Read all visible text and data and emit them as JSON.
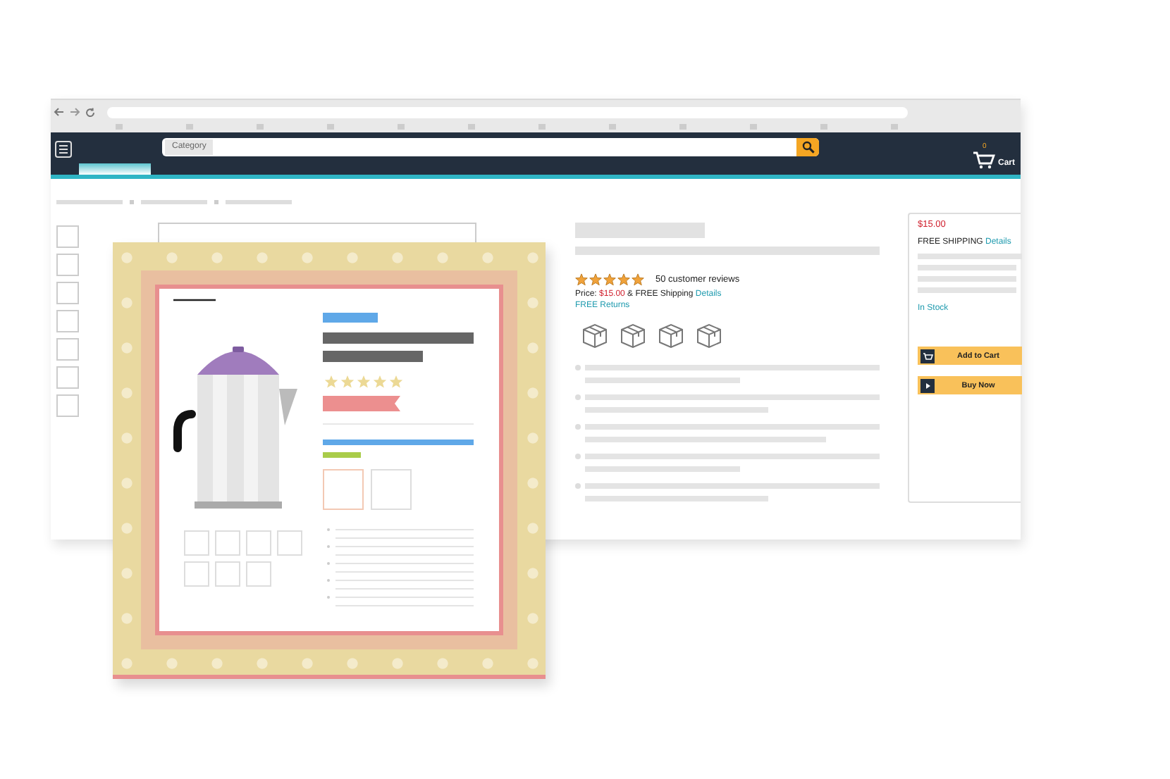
{
  "browser": {
    "search": {
      "category": "Category"
    },
    "cart": {
      "label": "Cart",
      "count": "0"
    }
  },
  "product": {
    "stars": 5,
    "reviews": "50 customer reviews",
    "price_label": "Price:",
    "price": "$15.00",
    "shipping": "& FREE Shipping",
    "details_link": "Details",
    "returns_link": "FREE Returns"
  },
  "buy_box": {
    "price": "$15.00",
    "shipping": "FREE SHIPPING",
    "details_link": "Details",
    "stock": "In Stock",
    "buttons": [
      {
        "label": "Add to Cart",
        "kind": "cart"
      },
      {
        "label": "Buy Now",
        "kind": "play"
      }
    ]
  },
  "poster": {
    "stars": 5
  }
}
